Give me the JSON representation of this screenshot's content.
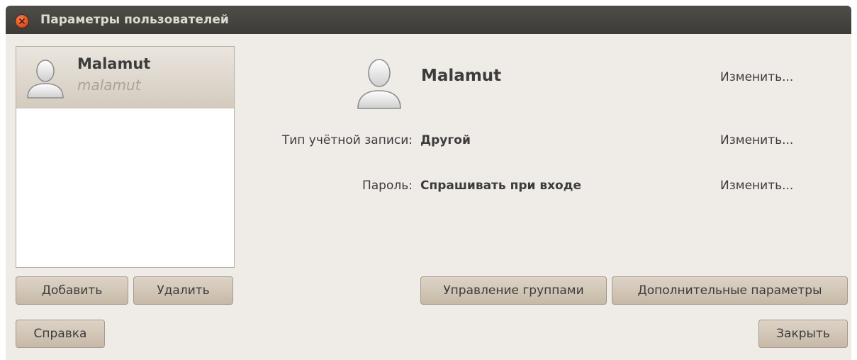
{
  "window": {
    "title": "Параметры пользователей"
  },
  "user_list": {
    "items": [
      {
        "name": "Malamut",
        "login": "malamut",
        "selected": true
      }
    ]
  },
  "details": {
    "display_name": "Malamut",
    "change_name_link": "Изменить...",
    "account_type_label": "Тип учётной записи:",
    "account_type_value": "Другой",
    "change_account_type_link": "Изменить...",
    "password_label": "Пароль:",
    "password_value": "Спрашивать при входе",
    "change_password_link": "Изменить..."
  },
  "buttons": {
    "add": "Добавить",
    "delete": "Удалить",
    "manage_groups": "Управление группами",
    "advanced": "Дополнительные параметры",
    "help": "Справка",
    "close": "Закрыть"
  },
  "icons": {
    "close": "close-icon",
    "avatar": "user-avatar-icon"
  },
  "colors": {
    "titlebar": "#3c3b37",
    "close_button": "#e2501c",
    "window_bg": "#efebe7",
    "selected_row": "#d4cbbe",
    "button_bg": "#ccbfae"
  }
}
